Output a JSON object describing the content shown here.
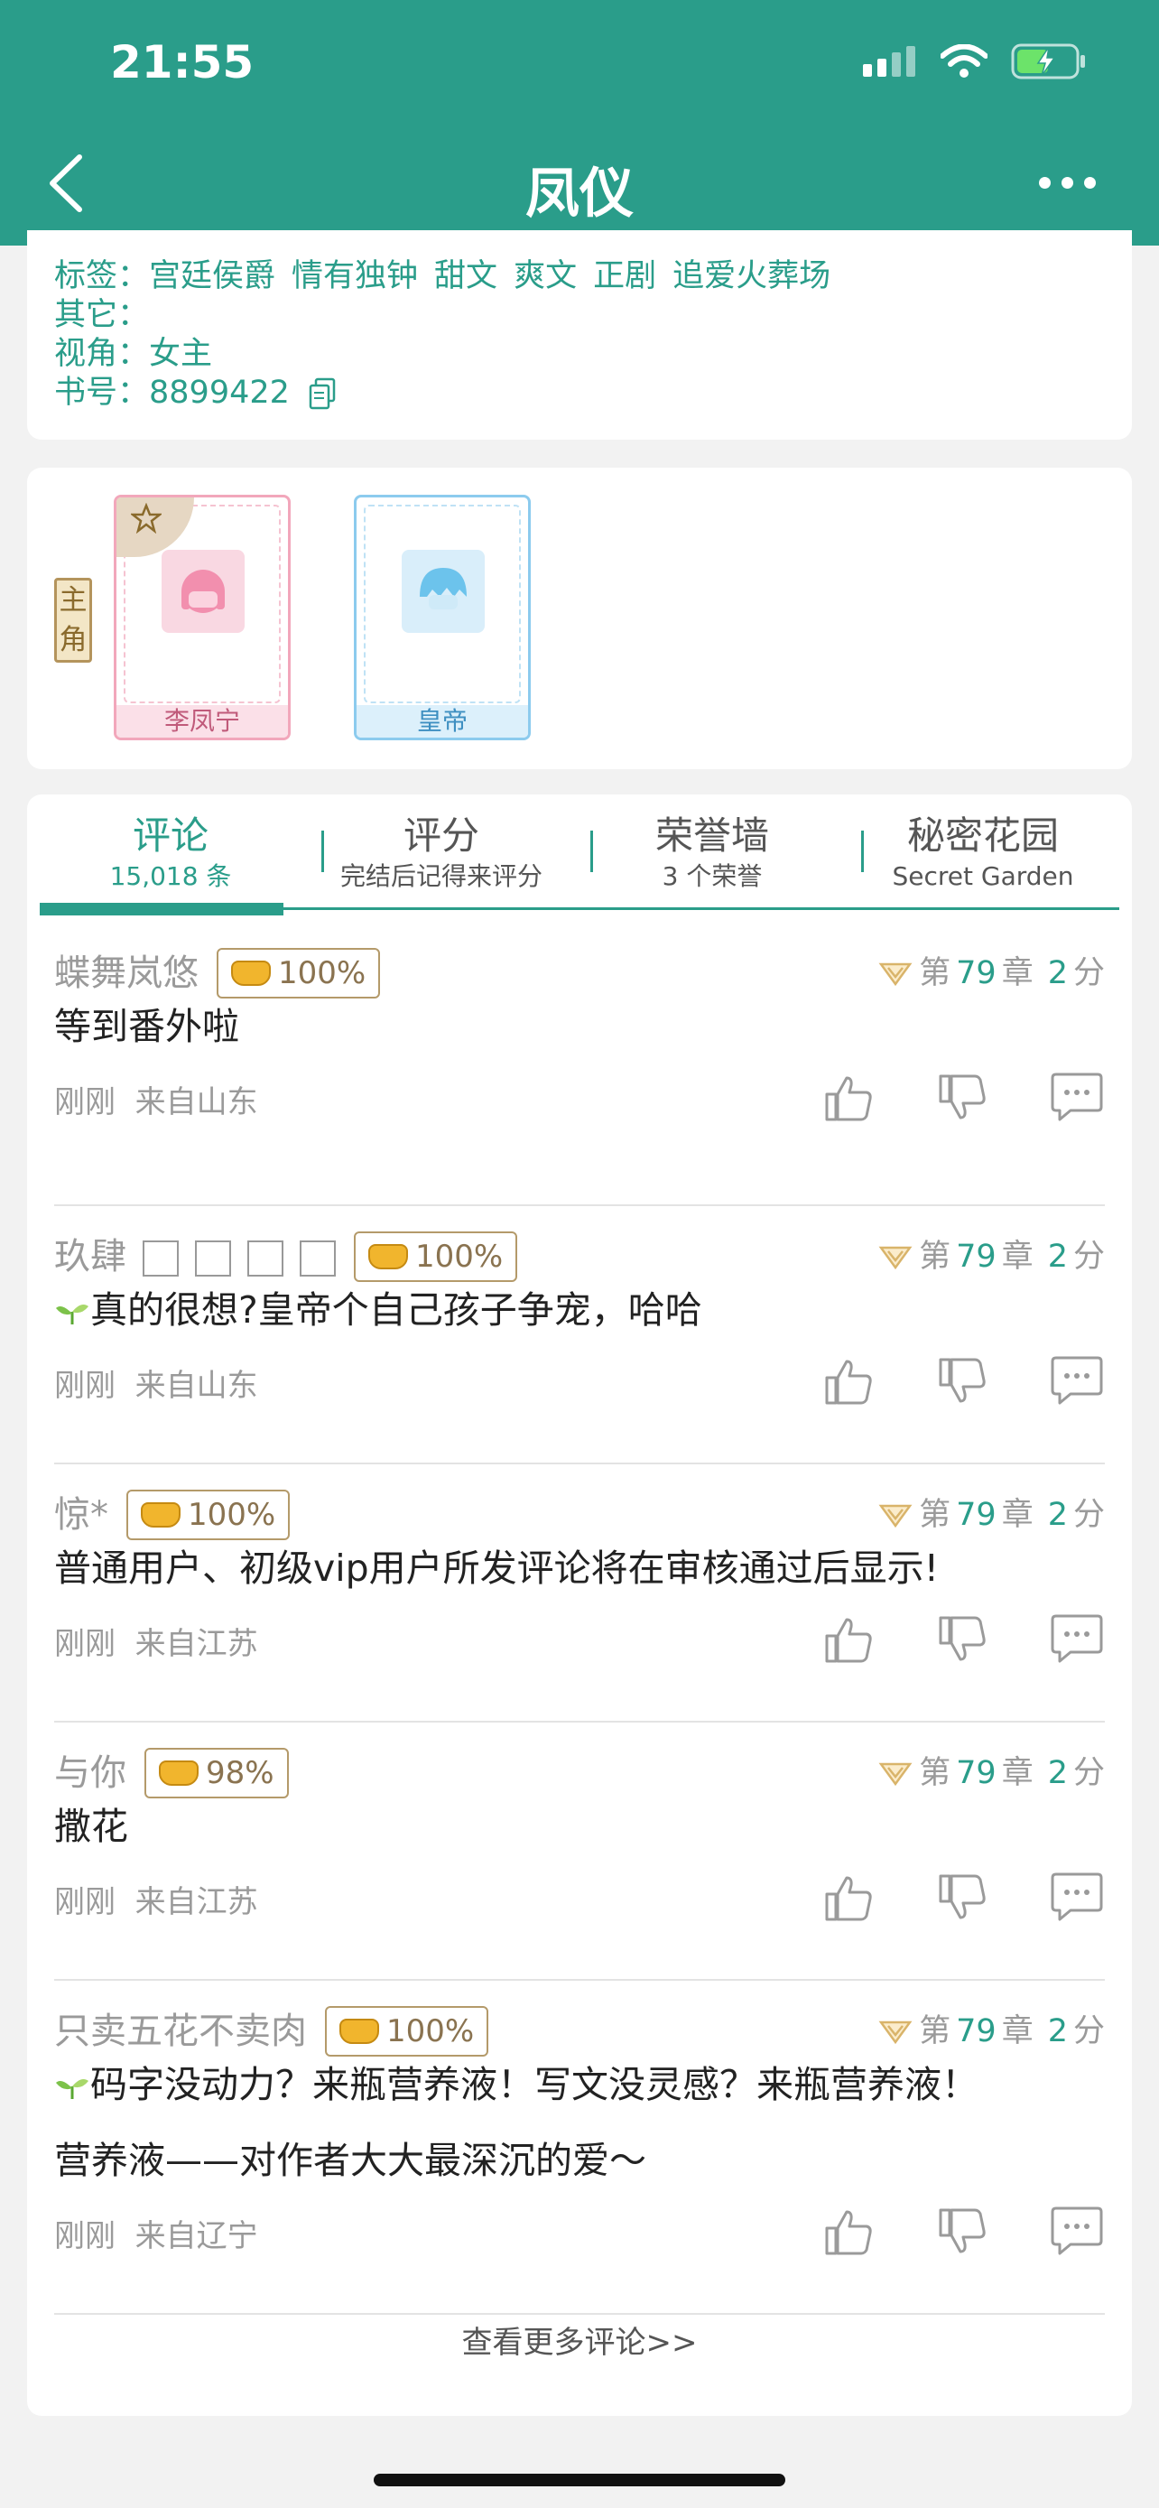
{
  "status": {
    "time": "21:55"
  },
  "nav": {
    "title": "凤仪"
  },
  "info": {
    "tags_label": "标签：",
    "tags": [
      "宫廷侯爵",
      "情有独钟",
      "甜文",
      "爽文",
      "正剧",
      "追爱火葬场"
    ],
    "other_label": "其它：",
    "perspective_label": "视角：",
    "perspective_value": "女主",
    "book_no_label": "书号：",
    "book_no_value": "8899422"
  },
  "roles": {
    "badge": "主角",
    "items": [
      {
        "name": "李凤宁"
      },
      {
        "name": "皇帝"
      }
    ]
  },
  "tabs": [
    {
      "title": "评论",
      "sub": "15,018 条"
    },
    {
      "title": "评分",
      "sub": "完结后记得来评分"
    },
    {
      "title": "荣誉墙",
      "sub": "3 个荣誉"
    },
    {
      "title": "秘密花园",
      "sub": "Secret Garden"
    }
  ],
  "comments": [
    {
      "user": "蝶舞岚悠",
      "badge": "100%",
      "chapter_prefix": "第",
      "chapter": "79",
      "chapter_suffix": "章",
      "score": "2",
      "score_unit": "分",
      "text": "等到番外啦",
      "time": "刚刚",
      "loc": "来自山东"
    },
    {
      "user": "玖肆",
      "badge": "100%",
      "chapter_prefix": "第",
      "chapter": "79",
      "chapter_suffix": "章",
      "score": "2",
      "score_unit": "分",
      "text": "真的很想?皇帝个自己孩子争宠，哈哈",
      "time": "刚刚",
      "loc": "来自山东"
    },
    {
      "user": "惊*",
      "badge": "100%",
      "chapter_prefix": "第",
      "chapter": "79",
      "chapter_suffix": "章",
      "score": "2",
      "score_unit": "分",
      "text": "普通用户、初级vip用户所发评论将在审核通过后显示!",
      "time": "刚刚",
      "loc": "来自江苏"
    },
    {
      "user": "与你",
      "badge": "98%",
      "chapter_prefix": "第",
      "chapter": "79",
      "chapter_suffix": "章",
      "score": "2",
      "score_unit": "分",
      "text": "撒花",
      "time": "刚刚",
      "loc": "来自江苏"
    },
    {
      "user": "只卖五花不卖肉",
      "badge": "100%",
      "chapter_prefix": "第",
      "chapter": "79",
      "chapter_suffix": "章",
      "score": "2",
      "score_unit": "分",
      "text": "码字没动力？来瓶营养液！写文没灵感？来瓶营养液！",
      "text2": "营养液——对作者大大最深沉的爱～",
      "time": "刚刚",
      "loc": "来自辽宁"
    }
  ],
  "more_link": "查看更多评论>>"
}
